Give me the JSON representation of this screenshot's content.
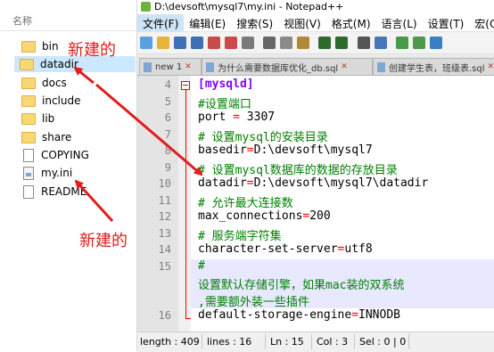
{
  "explorer": {
    "header": "名称",
    "items": [
      {
        "name": "bin",
        "type": "folder"
      },
      {
        "name": "datadir",
        "type": "folder",
        "selected": true
      },
      {
        "name": "docs",
        "type": "folder"
      },
      {
        "name": "include",
        "type": "folder"
      },
      {
        "name": "lib",
        "type": "folder"
      },
      {
        "name": "share",
        "type": "folder"
      },
      {
        "name": "COPYING",
        "type": "file"
      },
      {
        "name": "my.ini",
        "type": "ini"
      },
      {
        "name": "README",
        "type": "file"
      }
    ]
  },
  "annotations": {
    "top": "新建的",
    "bottom": "新建的",
    "color": "#e21d1d"
  },
  "window": {
    "title": "D:\\devsoft\\mysql7\\my.ini - Notepad++"
  },
  "menu": [
    "文件(F)",
    "编辑(E)",
    "搜索(S)",
    "视图(V)",
    "格式(M)",
    "语言(L)",
    "设置(T)",
    "宏(O)"
  ],
  "tabs": [
    {
      "label": "new 1",
      "active": false
    },
    {
      "label": "为什么需要数据库优化_db.sql",
      "active": false
    },
    {
      "label": "创建学生表，班级表.sql",
      "active": false
    }
  ],
  "editor": {
    "lines": [
      {
        "num": "4",
        "text": "[mysqld]",
        "kind": "section"
      },
      {
        "num": "5",
        "text": "#设置端口",
        "kind": "comment"
      },
      {
        "num": "6",
        "key": "port ",
        "val": " 3307",
        "kind": "kv"
      },
      {
        "num": "7",
        "text": "# 设置mysql的安装目录",
        "kind": "comment"
      },
      {
        "num": "8",
        "key": "basedir",
        "val": "D:\\devsoft\\mysql7",
        "kind": "kv"
      },
      {
        "num": "9",
        "text": "# 设置mysql数据库的数据的存放目录",
        "kind": "comment"
      },
      {
        "num": "10",
        "key": "datadir",
        "val": "D:\\devsoft\\mysql7\\datadir",
        "kind": "kv"
      },
      {
        "num": "11",
        "text": "# 允许最大连接数",
        "kind": "comment"
      },
      {
        "num": "12",
        "key": "max_connections",
        "val": "200",
        "kind": "kv"
      },
      {
        "num": "13",
        "text": "# 服务端字符集",
        "kind": "comment"
      },
      {
        "num": "14",
        "key": "character-set-server",
        "val": "utf8",
        "kind": "kv"
      },
      {
        "num": "15",
        "text": "#",
        "text2": "设置默认存储引擎，如果mac装的双系统",
        "text3": ",需要额外装一些插件",
        "kind": "comment-wrap"
      },
      {
        "num": "16",
        "key": "default-storage-engine",
        "val": "INNODB",
        "kind": "kv"
      }
    ],
    "equals": "="
  },
  "status": {
    "length": "length : 409",
    "lines": "lines : 16",
    "ln": "Ln : 15",
    "col": "Col : 3",
    "sel": "Sel : 0 | 0"
  }
}
